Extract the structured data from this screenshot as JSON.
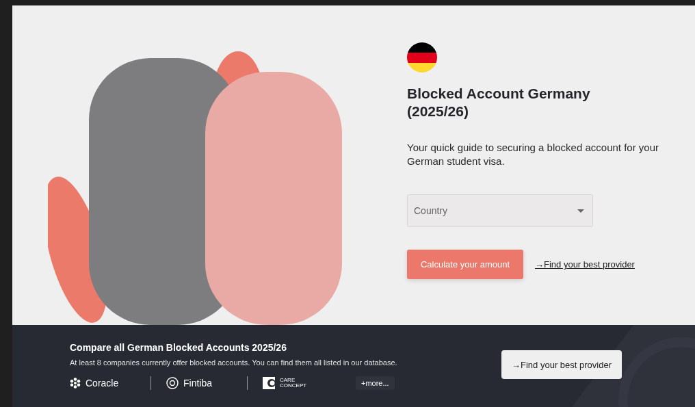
{
  "hero": {
    "title_line_1": "Blocked Account Germany",
    "title_line_2": "(2025/26)",
    "subtitle": "Your quick guide to securing a blocked account for your German student visa.",
    "country_select": {
      "placeholder": "Country"
    },
    "primary_button": "Calculate your amount",
    "secondary_link": "→Find your best provider"
  },
  "compare_bar": {
    "heading": "Compare all German Blocked Accounts 2025/26",
    "description": "At least 8 companies currently offer blocked accounts. You can find them all listed in our database.",
    "providers": [
      {
        "kind": "flower",
        "name": "Coracle"
      },
      {
        "kind": "ring",
        "name": "Fintiba"
      },
      {
        "kind": "block",
        "name": "CARE",
        "name_line_2": "CONCEPT"
      }
    ],
    "more_button": "+more...",
    "cta_button": "→Find your best provider"
  }
}
